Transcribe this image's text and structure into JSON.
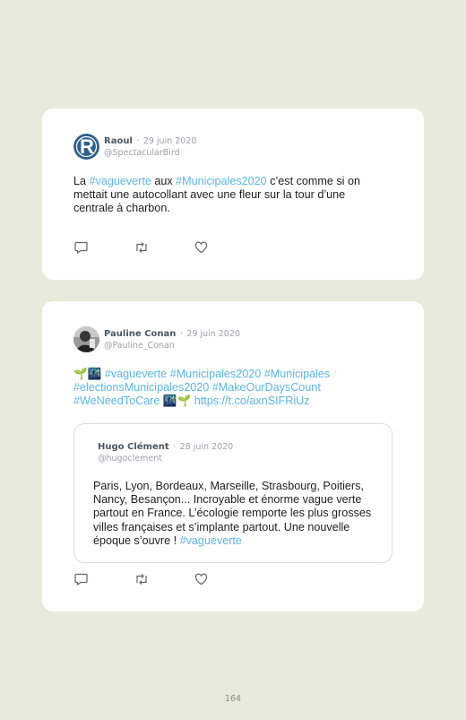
{
  "tweets": [
    {
      "author": "Raoul",
      "date": "29 juin 2020",
      "handle": "@SpectacularBird",
      "text": [
        {
          "t": "La ",
          "tag": false
        },
        {
          "t": "#vagueverte",
          "tag": true
        },
        {
          "t": " aux ",
          "tag": false
        },
        {
          "t": "#Municipales2020",
          "tag": true
        },
        {
          "t": " c’est comme si on mettait une autocollant avec une fleur sur la tour d’une centrale à charbon.",
          "tag": false
        }
      ]
    },
    {
      "author": "Pauline Conan",
      "date": "29 juin 2020",
      "handle": "@Pauline_Conan",
      "text": [
        {
          "t": "🌱🌃 ",
          "tag": false
        },
        {
          "t": "#vagueverte #Municipales2020 #Municipales #electionsMunicipales2020 #MakeOurDaysCount #WeNeedToCare",
          "tag": true
        },
        {
          "t": " 🌃🌱 ",
          "tag": false
        },
        {
          "t": "https://t.co/axnSIFRiUz",
          "tag": true
        }
      ],
      "quote": {
        "author": "Hugo Clément",
        "date": "28 juin 2020",
        "handle": "@hugoclement",
        "text": [
          {
            "t": "Paris, Lyon, Bordeaux, Marseille, Strasbourg, Poitiers, Nancy, Besançon... Incroyable et énorme vague verte partout en France. L’écologie remporte les plus grosses villes françaises et s’implante partout. Une nouvelle époque s’ouvre ! ",
            "tag": false
          },
          {
            "t": "#vagueverte",
            "tag": true
          }
        ]
      }
    }
  ],
  "separator": "·",
  "icons": [
    "reply-icon",
    "retweet-icon",
    "like-icon"
  ],
  "colors": {
    "background": "#e7ebd9",
    "hashtag": "#5bb6ea",
    "name": "#4a5763",
    "meta": "#9aa2aa"
  },
  "page_number": "164"
}
